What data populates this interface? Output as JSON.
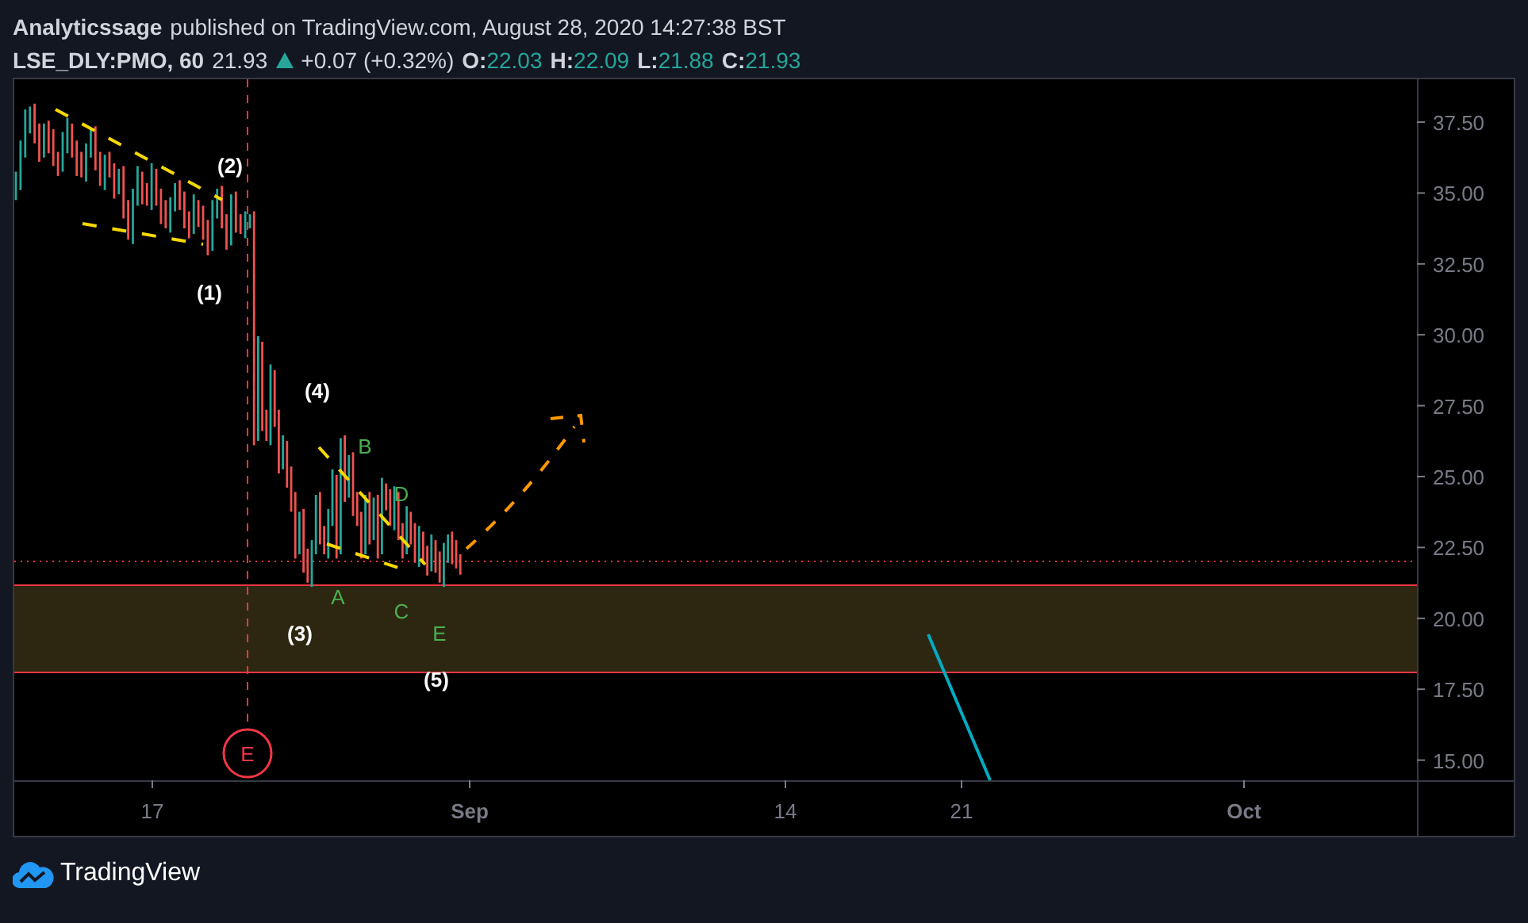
{
  "header": {
    "author": "Analyticssage",
    "published": "published on TradingView.com, August 28, 2020 14:27:38 BST",
    "symbol": "LSE_DLY:PMO, 60",
    "last": "21.93",
    "change": "+0.07 (+0.32%)",
    "ohlc": [
      {
        "label": "O:",
        "value": "22.03"
      },
      {
        "label": "H:",
        "value": "22.09"
      },
      {
        "label": "L:",
        "value": "21.88"
      },
      {
        "label": "C:",
        "value": "21.93"
      }
    ]
  },
  "chart": {
    "price_labels": [
      "37.50",
      "35.00",
      "32.50",
      "30.00",
      "27.50",
      "25.00",
      "22.50",
      "20.00",
      "17.50",
      "15.00"
    ],
    "time_labels": [
      {
        "label": "17",
        "kind": "day"
      },
      {
        "label": "Sep",
        "kind": "month"
      },
      {
        "label": "14",
        "kind": "day"
      },
      {
        "label": "21",
        "kind": "day"
      },
      {
        "label": "Oct",
        "kind": "month"
      }
    ],
    "wave_labels": [
      {
        "text": "(2)",
        "kind": "wave"
      },
      {
        "text": "(1)",
        "kind": "wave"
      },
      {
        "text": "(4)",
        "kind": "wave"
      },
      {
        "text": "B",
        "kind": "sub"
      },
      {
        "text": "D",
        "kind": "sub"
      },
      {
        "text": "A",
        "kind": "sub"
      },
      {
        "text": "C",
        "kind": "sub"
      },
      {
        "text": "E",
        "kind": "sub"
      },
      {
        "text": "(3)",
        "kind": "wave"
      },
      {
        "text": "(5)",
        "kind": "wave"
      }
    ],
    "event_marker": "E"
  },
  "footer": {
    "brand": "TradingView"
  }
}
